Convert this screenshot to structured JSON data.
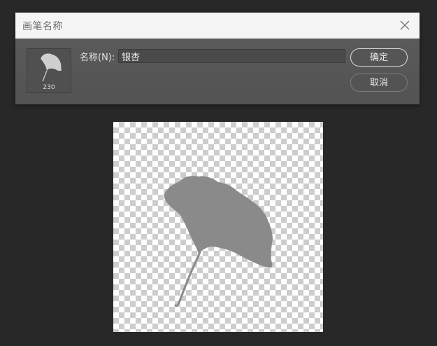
{
  "dialog": {
    "title": "画笔名称",
    "close_icon": "close-icon",
    "name_label": "名称(N):",
    "name_value": "银杏",
    "ok_label": "确定",
    "cancel_label": "取消"
  },
  "brush_preview": {
    "size": "230",
    "icon": "ginkgo-leaf-icon"
  },
  "canvas": {
    "content": "ginkgo-leaf-shape",
    "background": "transparency-checkerboard"
  },
  "colors": {
    "app_background": "#282828",
    "dialog_body": "#535353",
    "titlebar": "#f5f5f5",
    "leaf_fill": "#8a8a8a"
  }
}
